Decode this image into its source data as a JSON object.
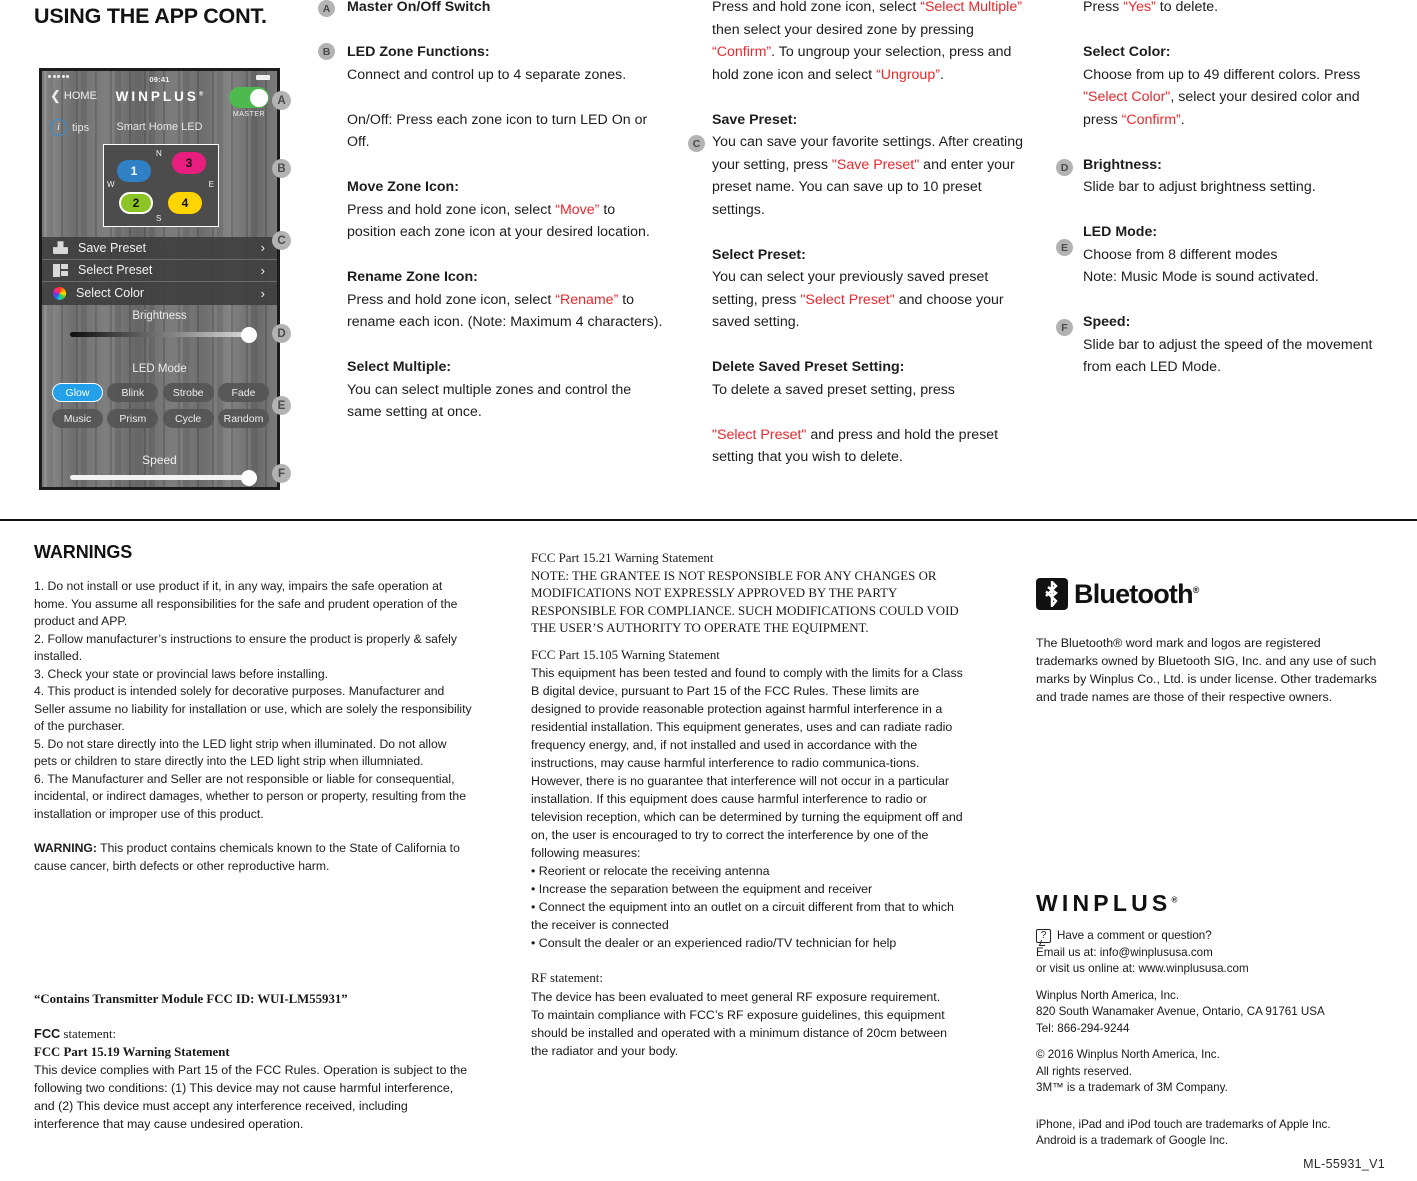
{
  "page_title": "USING THE APP CONT.",
  "phone": {
    "status_time": "09:41",
    "back_label": "HOME",
    "brand": "WINPLUS",
    "brand_sup": "®",
    "master_label": "MASTER",
    "tips_label": "tips",
    "tips_icon": "info-icon",
    "subtitle": "Smart Home LED",
    "zones": [
      {
        "label": "1",
        "color": "#2f80c4"
      },
      {
        "label": "2",
        "color": "#8cc425"
      },
      {
        "label": "3",
        "color": "#e81e7e"
      },
      {
        "label": "4",
        "color": "#ffd400"
      }
    ],
    "compass": {
      "n": "N",
      "s": "S",
      "w": "W",
      "e": "E"
    },
    "menu": [
      {
        "label": "Save Preset",
        "icon": "save-icon",
        "chevron": "›"
      },
      {
        "label": "Select Preset",
        "icon": "preset-icon",
        "chevron": "›"
      },
      {
        "label": "Select Color",
        "icon": "color-wheel-icon",
        "chevron": "›"
      }
    ],
    "brightness_label": "Brightness",
    "led_mode_label": "LED Mode",
    "modes_row1": [
      "Glow",
      "Blink",
      "Strobe",
      "Fade"
    ],
    "modes_row2": [
      "Music",
      "Prism",
      "Cycle",
      "Random"
    ],
    "active_mode": "Glow",
    "speed_label": "Speed"
  },
  "badges": {
    "a": "A",
    "b": "B",
    "c": "C",
    "d": "D",
    "e": "E",
    "f": "F"
  },
  "instructions": {
    "col1": {
      "a_heading": "Master On/Off Switch",
      "b_heading": "LED Zone Functions:",
      "b_body": "Connect and control up to 4 separate zones.",
      "onoff": "On/Off: Press each zone icon to turn LED On or Off.",
      "move_heading": "Move Zone Icon:",
      "move_p1": "Press and hold zone icon, select ",
      "move_q": "“Move”",
      "move_p2": " to position each zone icon at your desired location.",
      "rename_heading": "Rename Zone Icon:",
      "rename_p1": "Press and hold zone icon, select ",
      "rename_q": "“Rename”",
      "rename_p2": " to rename each icon. (Note: Maximum 4 characters).",
      "multiple_heading": "Select Multiple:",
      "multiple_body": "You can select multiple zones and control the same setting at once."
    },
    "col2": {
      "sm_p1": "Press and hold zone icon, select ",
      "sm_q1": "“Select Multiple”",
      "sm_p2": " then select your desired zone by pressing ",
      "sm_q2": "“Confirm”",
      "sm_p3": ".  To ungroup your selection, press and hold zone icon and select ",
      "sm_q3": "“Ungroup”",
      "sm_p4": ".",
      "save_heading": "Save Preset:",
      "save_p1": "You can save your favorite settings. After creating your setting, press ",
      "save_q": "\"Save Preset\"",
      "save_p2": " and enter your preset name. You can save up to 10 preset settings.",
      "select_heading": "Select Preset:",
      "select_p1": "You can select your previously saved preset setting, press ",
      "select_q": "\"Select Preset\"",
      "select_p2": " and choose your saved setting.",
      "delete_heading": "Delete Saved Preset Setting:",
      "delete_p1": "To delete a saved preset setting, press",
      "delete_q": "\"Select Preset\"",
      "delete_p2": " and press and hold the preset setting that you wish to delete."
    },
    "col3": {
      "yes_p1": "Press ",
      "yes_q": "“Yes”",
      "yes_p2": " to delete.",
      "color_heading": "Select Color:",
      "color_p1": "Choose from up to 49 different colors. Press ",
      "color_q1": "\"Select Color\"",
      "color_p2": ", select your desired color and press ",
      "color_q2": "“Confirm”",
      "color_p3": ".",
      "brightness_heading": "Brightness:",
      "brightness_body": "Slide bar to adjust brightness setting.",
      "ledmode_heading": "LED Mode:",
      "ledmode_body1": "Choose from 8 different modes",
      "ledmode_body2": "Note: Music Mode is sound activated.",
      "speed_heading": "Speed:",
      "speed_body": "Slide bar to adjust the speed of the movement from each LED Mode."
    }
  },
  "warnings": {
    "title": "WARNINGS",
    "items": [
      "1.  Do not install or use product if it, in any way, impairs the safe operation at home.  You assume all responsibilities for the safe and prudent operation of the product and APP.",
      "2.  Follow manufacturer’s instructions to ensure the product is properly & safely installed.",
      "3.  Check your state or provincial laws before installing.",
      "4.  This product is intended solely for decorative purposes. Manufacturer and Seller assume no liability for installation or use, which are solely the responsibility of the purchaser.",
      "5. Do not stare directly into the LED light strip when illuminated. Do not allow pets or children to stare directly into the LED light strip when illumniated.",
      "6.  The Manufacturer and Seller are not responsible or liable for consequential, incidental, or indirect damages, whether to person or property, resulting from the installation or improper use of this product."
    ],
    "prop65_bold": "WARNING:",
    "prop65_body": " This product contains chemicals known to the State of California  to cause cancer, birth defects or other reproductive harm."
  },
  "fcc_left": {
    "transmitter_module": "“Contains Transmitter Module FCC ID: WUI-LM55931”",
    "fcc_statement_bold": "FCC",
    "fcc_statement_rest": " statement:",
    "part_1519_heading": "FCC Part 15.19 Warning Statement",
    "part_1519_body": "This device complies with Part 15 of the FCC Rules. Operation is subject to the following two conditions: (1) This device may not cause harmful interference, and (2) This device must accept any interference received, including interference that may cause undesired operation."
  },
  "fcc_mid": {
    "part_1521_heading": "FCC Part 15.21 Warning Statement",
    "part_1521_body": "NOTE:   THE GRANTEE IS NOT RESPONSIBLE FOR ANY CHANGES OR MODIFICATIONS NOT EXPRESSLY APPROVED BY THE PARTY RESPONSIBLE FOR COMPLIANCE. SUCH MODIFICATIONS COULD VOID THE USER’S AUTHORITY TO OPERATE THE EQUIPMENT.",
    "part_15105_heading": "FCC Part 15.105 Warning Statement",
    "part_15105_body": "This equipment has been tested and found to comply with the limits for a Class B digital device, pursuant to Part 15 of the FCC Rules. These limits are designed to provide reasonable protection against harmful interference in a residential installation. This equipment generates, uses and can radiate radio frequency energy, and, if not installed and used in accordance with the instructions, may cause harmful interference to radio communica-tions. However, there is no guarantee that interference will not occur in a particular installation. If this equipment does cause harmful interference to radio or television reception, which can be determined by turning the equipment off and on, the user is encouraged to try to correct the interference by one of the following measures:",
    "bullets": [
      "• Reorient or relocate the receiving antenna",
      "• Increase the separation between the equipment and receiver",
      "• Connect the equipment into an outlet on a circuit different from that to which the receiver is connected",
      "• Consult the dealer or an experienced radio/TV technician for help"
    ],
    "rf_heading": "RF statement:",
    "rf_body1": "The device has been evaluated to meet general RF exposure requirement.",
    "rf_body2": "To maintain compliance with FCC’s RF exposure guidelines, this equipment should be installed and operated with a minimum distance of 20cm between the radiator and your body."
  },
  "bluetooth": {
    "wordmark": "Bluetooth",
    "wordmark_sup": "®",
    "icon": "bluetooth-icon",
    "notice": "The Bluetooth® word mark and logos are registered trademarks owned by Bluetooth SIG, Inc. and any use of such marks by Winplus Co., Ltd. is under license. Other trademarks and trade names are those of their respective owners."
  },
  "contact": {
    "logo": "WINPLUS",
    "logo_sup": "®",
    "question_line": "Have a comment or question?",
    "email_line": "Email us at: info@winplususa.com",
    "web_line": "or visit us online at: www.winplususa.com",
    "company": "Winplus North America, Inc.",
    "address": "820 South Wanamaker Avenue, Ontario, CA 91761 USA",
    "tel": "Tel: 866-294-9244",
    "copyright": "© 2016 Winplus North America, Inc.",
    "rights": "All rights reserved.",
    "trademark_3m": "3M™ is a trademark of 3M Company.",
    "apple_tm": "iPhone, iPad and iPod touch are trademarks of Apple Inc.",
    "android_tm": "Android is a trademark of Google Inc."
  },
  "footer_code": "ML-55931_V1"
}
